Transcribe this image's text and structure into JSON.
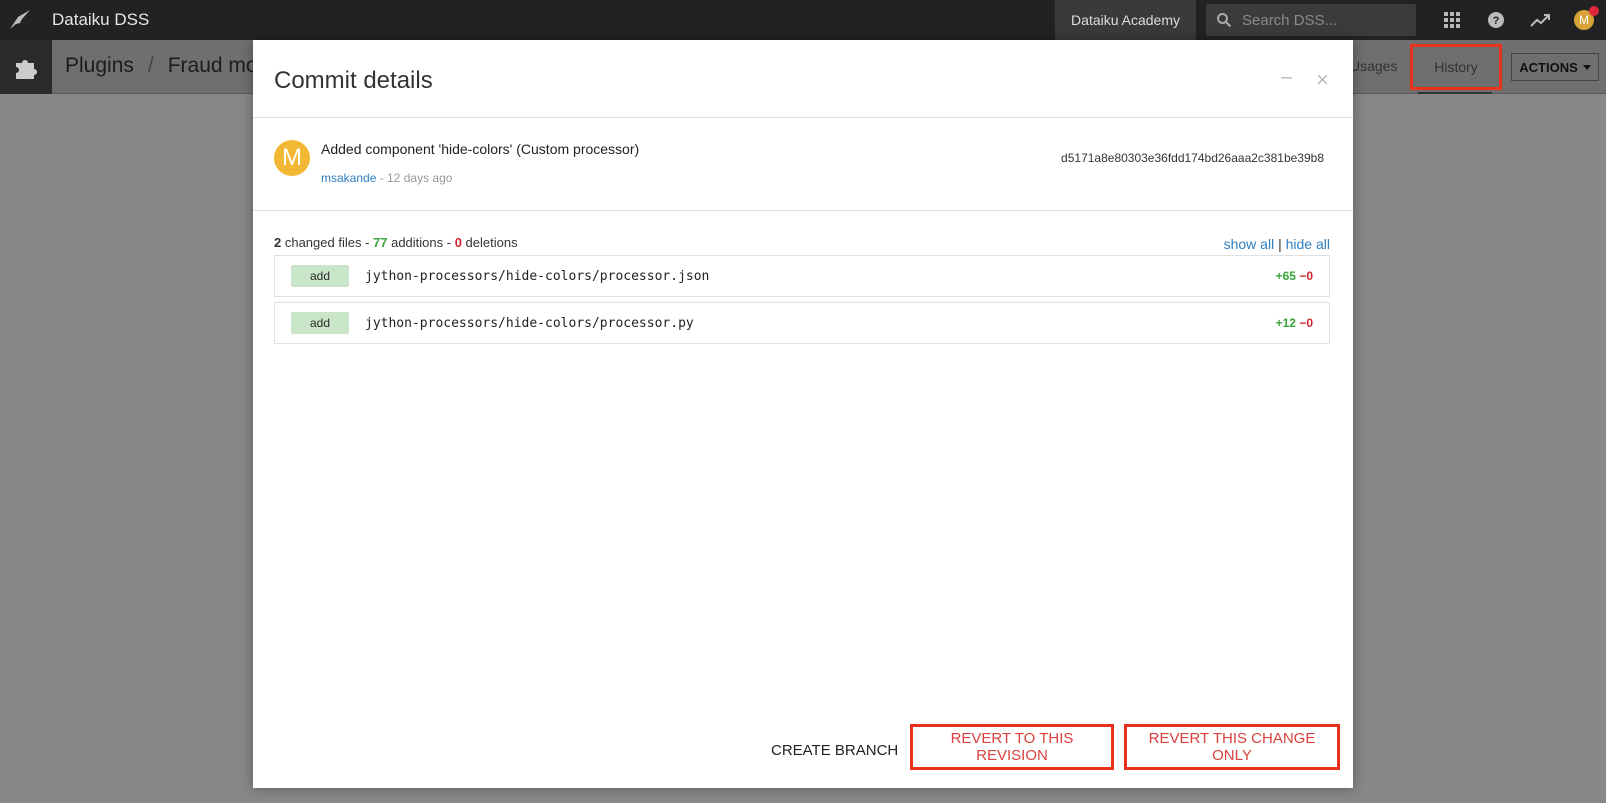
{
  "topnav": {
    "app_title": "Dataiku DSS",
    "academy_label": "Dataiku Academy",
    "search_placeholder": "Search DSS...",
    "avatar_letter": "M"
  },
  "subbar": {
    "crumb_root": "Plugins",
    "crumb_separator": "/",
    "crumb_current": "Fraud mon",
    "usages_label": "Usages",
    "history_label": "History",
    "actions_label": "ACTIONS"
  },
  "modal": {
    "title": "Commit details",
    "minimize_glyph": "–",
    "close_glyph": "×",
    "commit": {
      "avatar_letter": "M",
      "message": "Added component 'hide-colors' (Custom processor)",
      "author": "msakande",
      "time": " - 12 days ago",
      "hash": "d5171a8e80303e36fdd174bd26aaa2c381be39b8"
    },
    "summary": {
      "changed_files": "2",
      "changed_files_label": " changed files - ",
      "additions": "77",
      "additions_label": " additions - ",
      "deletions": "0",
      "deletions_label": " deletions"
    },
    "show_all": "show all",
    "links_sep": "|",
    "hide_all": "hide all",
    "files": [
      {
        "badge": "add",
        "path": "jython-processors/hide-colors/processor.json",
        "plus": "+65",
        "minus": "−0"
      },
      {
        "badge": "add",
        "path": "jython-processors/hide-colors/processor.py",
        "plus": "+12",
        "minus": "−0"
      }
    ],
    "buttons": {
      "create_branch": "CREATE BRANCH",
      "revert_revision": "REVERT TO THIS REVISION",
      "revert_change": "REVERT THIS CHANGE ONLY"
    }
  }
}
